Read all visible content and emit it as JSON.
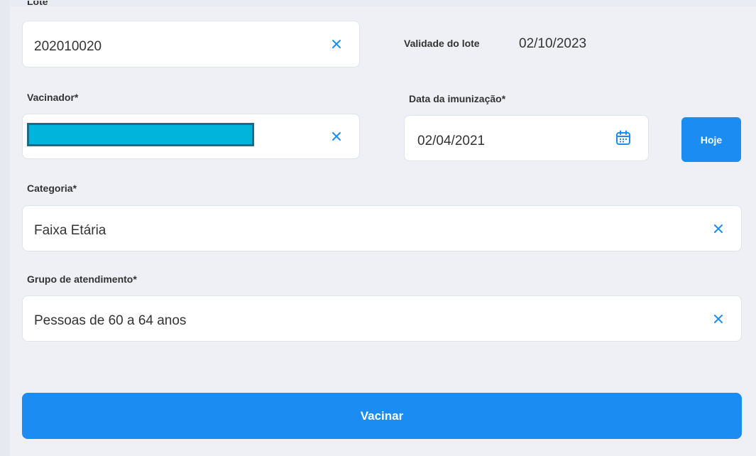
{
  "form": {
    "lote": {
      "label": "Lote",
      "value": "202010020",
      "clear_icon": "close-icon"
    },
    "validade": {
      "label": "Validade do lote",
      "value": "02/10/2023"
    },
    "vacinador": {
      "label": "Vacinador*",
      "value": "",
      "clear_icon": "close-icon"
    },
    "data_imunizacao": {
      "label": "Data da imunização*",
      "value": "02/04/2021",
      "icon": "calendar-icon"
    },
    "hoje_button": "Hoje",
    "categoria": {
      "label": "Categoria*",
      "value": "Faixa Etária",
      "clear_icon": "close-icon"
    },
    "grupo": {
      "label": "Grupo de atendimento*",
      "value": "Pessoas de 60 a 64 anos",
      "clear_icon": "close-icon"
    },
    "submit_button": "Vacinar"
  },
  "colors": {
    "accent": "#1a8cf2",
    "redaction": "#00b4dc"
  }
}
